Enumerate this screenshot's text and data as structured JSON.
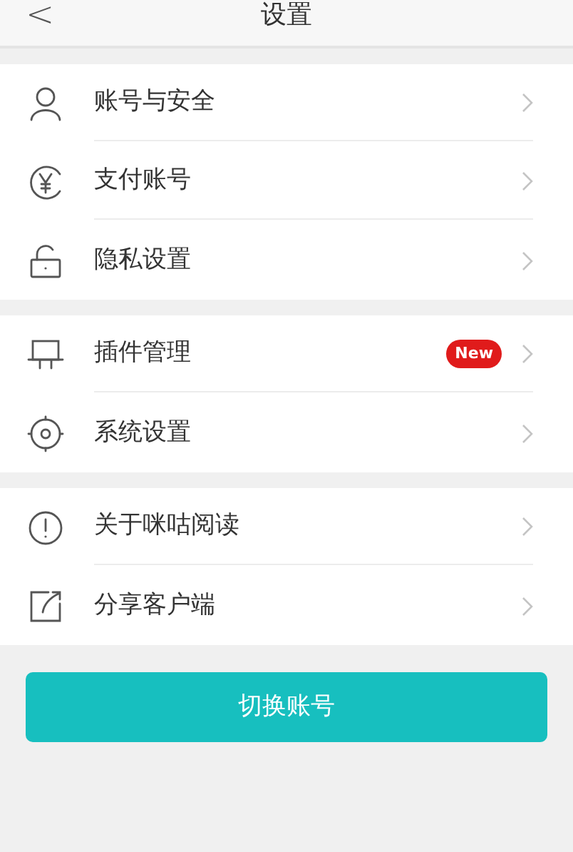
{
  "header": {
    "back": "<",
    "title": "设置"
  },
  "sections": [
    {
      "items": [
        {
          "label": "账号与安全"
        },
        {
          "label": "支付账号"
        },
        {
          "label": "隐私设置"
        }
      ]
    },
    {
      "items": [
        {
          "label": "插件管理",
          "badge": "New"
        },
        {
          "label": "系统设置"
        }
      ]
    },
    {
      "items": [
        {
          "label": "关于咪咕阅读"
        },
        {
          "label": "分享客户端"
        }
      ]
    }
  ],
  "switch_button": "切换账号"
}
